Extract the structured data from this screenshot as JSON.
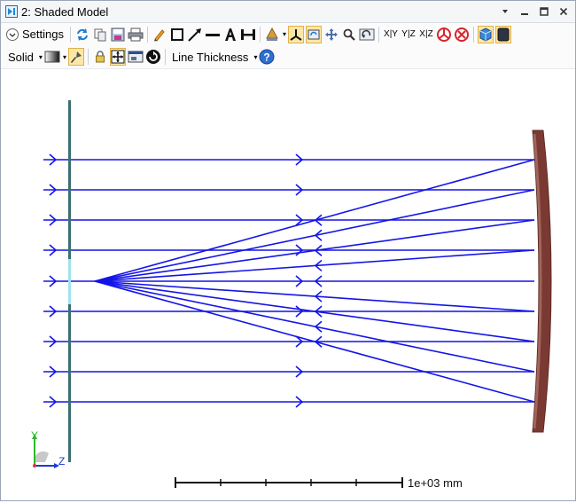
{
  "window": {
    "title": "2: Shaded Model",
    "controls": [
      "dropdown",
      "minimize",
      "maximize",
      "close"
    ]
  },
  "toolbar1": {
    "settings_label": "Settings",
    "axis_labels": [
      "X|Y",
      "Y|Z",
      "X|Z"
    ]
  },
  "toolbar2": {
    "render_mode": "Solid",
    "line_thickness_label": "Line Thickness"
  },
  "scene": {
    "scale_label": "1e+03 mm",
    "axis_triad": {
      "y": "Y",
      "z": "Z"
    },
    "colors": {
      "rays": "#1414e6",
      "plane": "#3a6f73",
      "plane_highlight": "#9fe3ec",
      "mirror": "#7a3a33",
      "mirror_light": "#a0655b",
      "triad_y": "#2db82d",
      "triad_z": "#1a3ad6"
    }
  }
}
